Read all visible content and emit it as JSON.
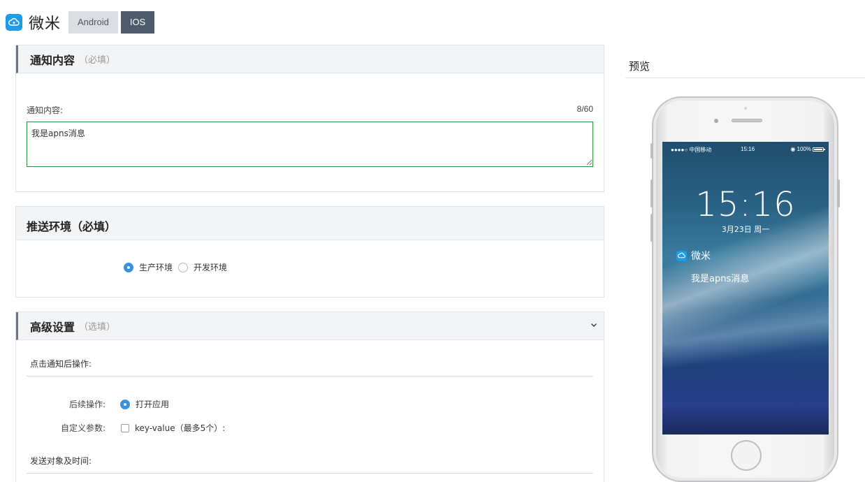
{
  "app": {
    "name": "微米",
    "logo_icon": "cloud-icon",
    "brand_color": "#1e9be6"
  },
  "platform_tabs": [
    {
      "label": "Android",
      "active": false
    },
    {
      "label": "IOS",
      "active": true
    }
  ],
  "notification_panel": {
    "title": "通知内容",
    "subtitle": "（必填）",
    "field_label": "通知内容:",
    "char_count": "8/60",
    "content_value": "我是apns消息"
  },
  "environment_panel": {
    "title": "推送环境（必填）",
    "options": [
      {
        "label": "生产环境",
        "checked": true
      },
      {
        "label": "开发环境",
        "checked": false
      }
    ]
  },
  "advanced_panel": {
    "title": "高级设置",
    "subtitle": "（选填）",
    "expand_icon": "chevron-down-icon",
    "section_click": "点击通知后操作:",
    "follow_up_label": "后续操作:",
    "follow_up_option": "打开应用",
    "follow_up_checked": true,
    "custom_params_label": "自定义参数:",
    "custom_params_option": "key-value（最多5个）:",
    "custom_params_checked": false,
    "section_target": "发送对象及时间:"
  },
  "preview": {
    "title": "预览",
    "status_bar": {
      "left": "●●●●○ 中国移动 ",
      "time": "15:16",
      "right": "◉ 100%"
    },
    "lock_time": "15:16",
    "lock_date": "3月23日  周一",
    "notification_app": "微米",
    "notification_message": "我是apns消息"
  }
}
